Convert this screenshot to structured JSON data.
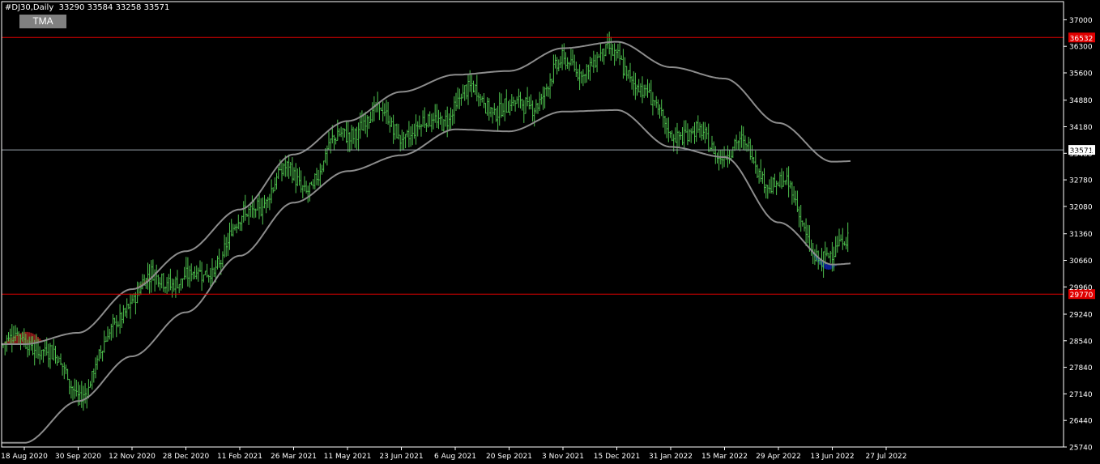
{
  "header": {
    "symbol": "#DJ30,Daily",
    "ohlc": "33290 33584 33258 33571",
    "indicator_button": "TMA"
  },
  "colors": {
    "background": "#000000",
    "candles": "#4ec24e",
    "tma_line": "#8c8c8c",
    "upper_fill": "#8b1a1a",
    "lower_fill": "#0b1f9c",
    "level_line": "#e00000",
    "price_line": "#9aa4ae",
    "axis": "#ffffff"
  },
  "chart_data": {
    "type": "line",
    "ylim": [
      25740,
      37350
    ],
    "y_ticks": [
      37000,
      36300,
      35600,
      34880,
      34180,
      33480,
      32780,
      32080,
      31360,
      30660,
      29960,
      29240,
      28540,
      27840,
      27140,
      26440,
      25740
    ],
    "x_ticks": [
      "18 Aug 2020",
      "30 Sep 2020",
      "12 Nov 2020",
      "28 Dec 2020",
      "11 Feb 2021",
      "26 Mar 2021",
      "11 May 2021",
      "23 Jun 2021",
      "6 Aug 2021",
      "20 Sep 2021",
      "3 Nov 2021",
      "15 Dec 2021",
      "31 Jan 2022",
      "15 Mar 2022",
      "29 Apr 2022",
      "13 Jun 2022",
      "27 Jul 2022"
    ],
    "levels": [
      {
        "label": "36532",
        "value": 36532
      },
      {
        "label": "29770",
        "value": 29770
      }
    ],
    "current_price": {
      "label": "33571",
      "value": 33571
    },
    "tma_upper": [
      {
        "x": "18 Aug 2020",
        "y": 28450
      },
      {
        "x": "30 Sep 2020",
        "y": 28750
      },
      {
        "x": "12 Nov 2020",
        "y": 29900
      },
      {
        "x": "28 Dec 2020",
        "y": 30900
      },
      {
        "x": "11 Feb 2021",
        "y": 32000
      },
      {
        "x": "26 Mar 2021",
        "y": 33450
      },
      {
        "x": "11 May 2021",
        "y": 34330
      },
      {
        "x": "23 Jun 2021",
        "y": 35100
      },
      {
        "x": "6 Aug 2021",
        "y": 35550
      },
      {
        "x": "20 Sep 2021",
        "y": 35650
      },
      {
        "x": "3 Nov 2021",
        "y": 36250
      },
      {
        "x": "15 Dec 2021",
        "y": 36420
      },
      {
        "x": "31 Jan 2022",
        "y": 35750
      },
      {
        "x": "15 Mar 2022",
        "y": 35450
      },
      {
        "x": "29 Apr 2022",
        "y": 34280
      },
      {
        "x": "13 Jun 2022",
        "y": 33260
      },
      {
        "x": "27 Jul 2022",
        "y": 33320
      }
    ],
    "tma_lower": [
      {
        "x": "18 Aug 2020",
        "y": 25850
      },
      {
        "x": "30 Sep 2020",
        "y": 26950
      },
      {
        "x": "12 Nov 2020",
        "y": 28130
      },
      {
        "x": "28 Dec 2020",
        "y": 29290
      },
      {
        "x": "11 Feb 2021",
        "y": 30780
      },
      {
        "x": "26 Mar 2021",
        "y": 32180
      },
      {
        "x": "11 May 2021",
        "y": 33010
      },
      {
        "x": "23 Jun 2021",
        "y": 33430
      },
      {
        "x": "6 Aug 2021",
        "y": 34110
      },
      {
        "x": "20 Sep 2021",
        "y": 34060
      },
      {
        "x": "3 Nov 2021",
        "y": 34580
      },
      {
        "x": "15 Dec 2021",
        "y": 34620
      },
      {
        "x": "31 Jan 2022",
        "y": 33650
      },
      {
        "x": "15 Mar 2022",
        "y": 33380
      },
      {
        "x": "29 Apr 2022",
        "y": 31660
      },
      {
        "x": "13 Jun 2022",
        "y": 30550
      },
      {
        "x": "27 Jul 2022",
        "y": 30660
      }
    ],
    "price_path": [
      {
        "x": "18 Aug 2020",
        "y": 28250
      },
      {
        "x": "30 Sep 2020",
        "y": 27650
      },
      {
        "x": "12 Nov 2020",
        "y": 29450
      },
      {
        "x": "28 Dec 2020",
        "y": 30350
      },
      {
        "x": "11 Feb 2021",
        "y": 31450
      },
      {
        "x": "26 Mar 2021",
        "y": 32800
      },
      {
        "x": "11 May 2021",
        "y": 34150
      },
      {
        "x": "23 Jun 2021",
        "y": 33950
      },
      {
        "x": "6 Aug 2021",
        "y": 35050
      },
      {
        "x": "20 Sep 2021",
        "y": 34300
      },
      {
        "x": "3 Nov 2021",
        "y": 36050
      },
      {
        "x": "15 Dec 2021",
        "y": 35600
      },
      {
        "x": "31 Jan 2022",
        "y": 34550
      },
      {
        "x": "15 Mar 2022",
        "y": 33300
      },
      {
        "x": "29 Apr 2022",
        "y": 33000
      },
      {
        "x": "13 Jun 2022",
        "y": 30450
      },
      {
        "x": "27 Jul 2022",
        "y": 32300
      },
      {
        "x": "27 Jul 2022",
        "y": 33571
      }
    ]
  }
}
